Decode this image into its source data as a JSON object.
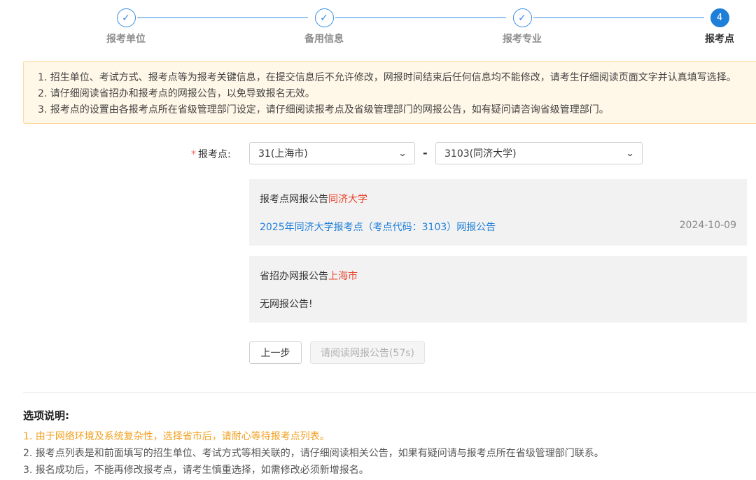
{
  "steps": [
    {
      "label": "报考单位",
      "state": "done",
      "icon": "check-icon"
    },
    {
      "label": "备用信息",
      "state": "done",
      "icon": "check-icon"
    },
    {
      "label": "报考专业",
      "state": "done",
      "icon": "check-icon"
    },
    {
      "label": "报考点",
      "state": "active",
      "number": "4"
    }
  ],
  "notice": {
    "lines": [
      "1. 招生单位、考试方式、报考点等为报考关键信息，在提交信息后不允许修改，网报时间结束后任何信息均不能修改，请考生仔细阅读页面文字并认真填写选择。",
      "2. 请仔细阅读省招办和报考点的网报公告，以免导致报名无效。",
      "3. 报考点的设置由各报考点所在省级管理部门设定，请仔细阅读报考点及省级管理部门的网报公告，如有疑问请咨询省级管理部门。"
    ]
  },
  "form": {
    "required_mark": "*",
    "label": "报考点:",
    "province_value": "31(上海市)",
    "separator": "-",
    "site_value": "3103(同济大学)"
  },
  "site_announcement": {
    "title": "报考点网报公告",
    "highlight": "同济大学",
    "link_text": "2025年同济大学报考点（考点代码：3103）网报公告",
    "date": "2024-10-09"
  },
  "province_announcement": {
    "title": "省招办网报公告",
    "highlight": "上海市",
    "empty_text": "无网报公告!"
  },
  "buttons": {
    "prev": "上一步",
    "read": "请阅读网报公告(57s)"
  },
  "explanation": {
    "title": "选项说明:",
    "items": [
      "1. 由于网络环境及系统复杂性，选择省市后，请耐心等待报考点列表。",
      "2. 报考点列表是和前面填写的招生单位、考试方式等相关联的，请仔细阅读相关公告，如果有疑问请与报考点所在省级管理部门联系。",
      "3. 报名成功后，不能再修改报考点，请考生慎重选择，如需修改必须新增报名。"
    ]
  },
  "colors": {
    "accent": "#1e7fd8",
    "highlight": "#e8452d",
    "warn": "#f0a020",
    "notice_bg": "#fff7e8"
  }
}
